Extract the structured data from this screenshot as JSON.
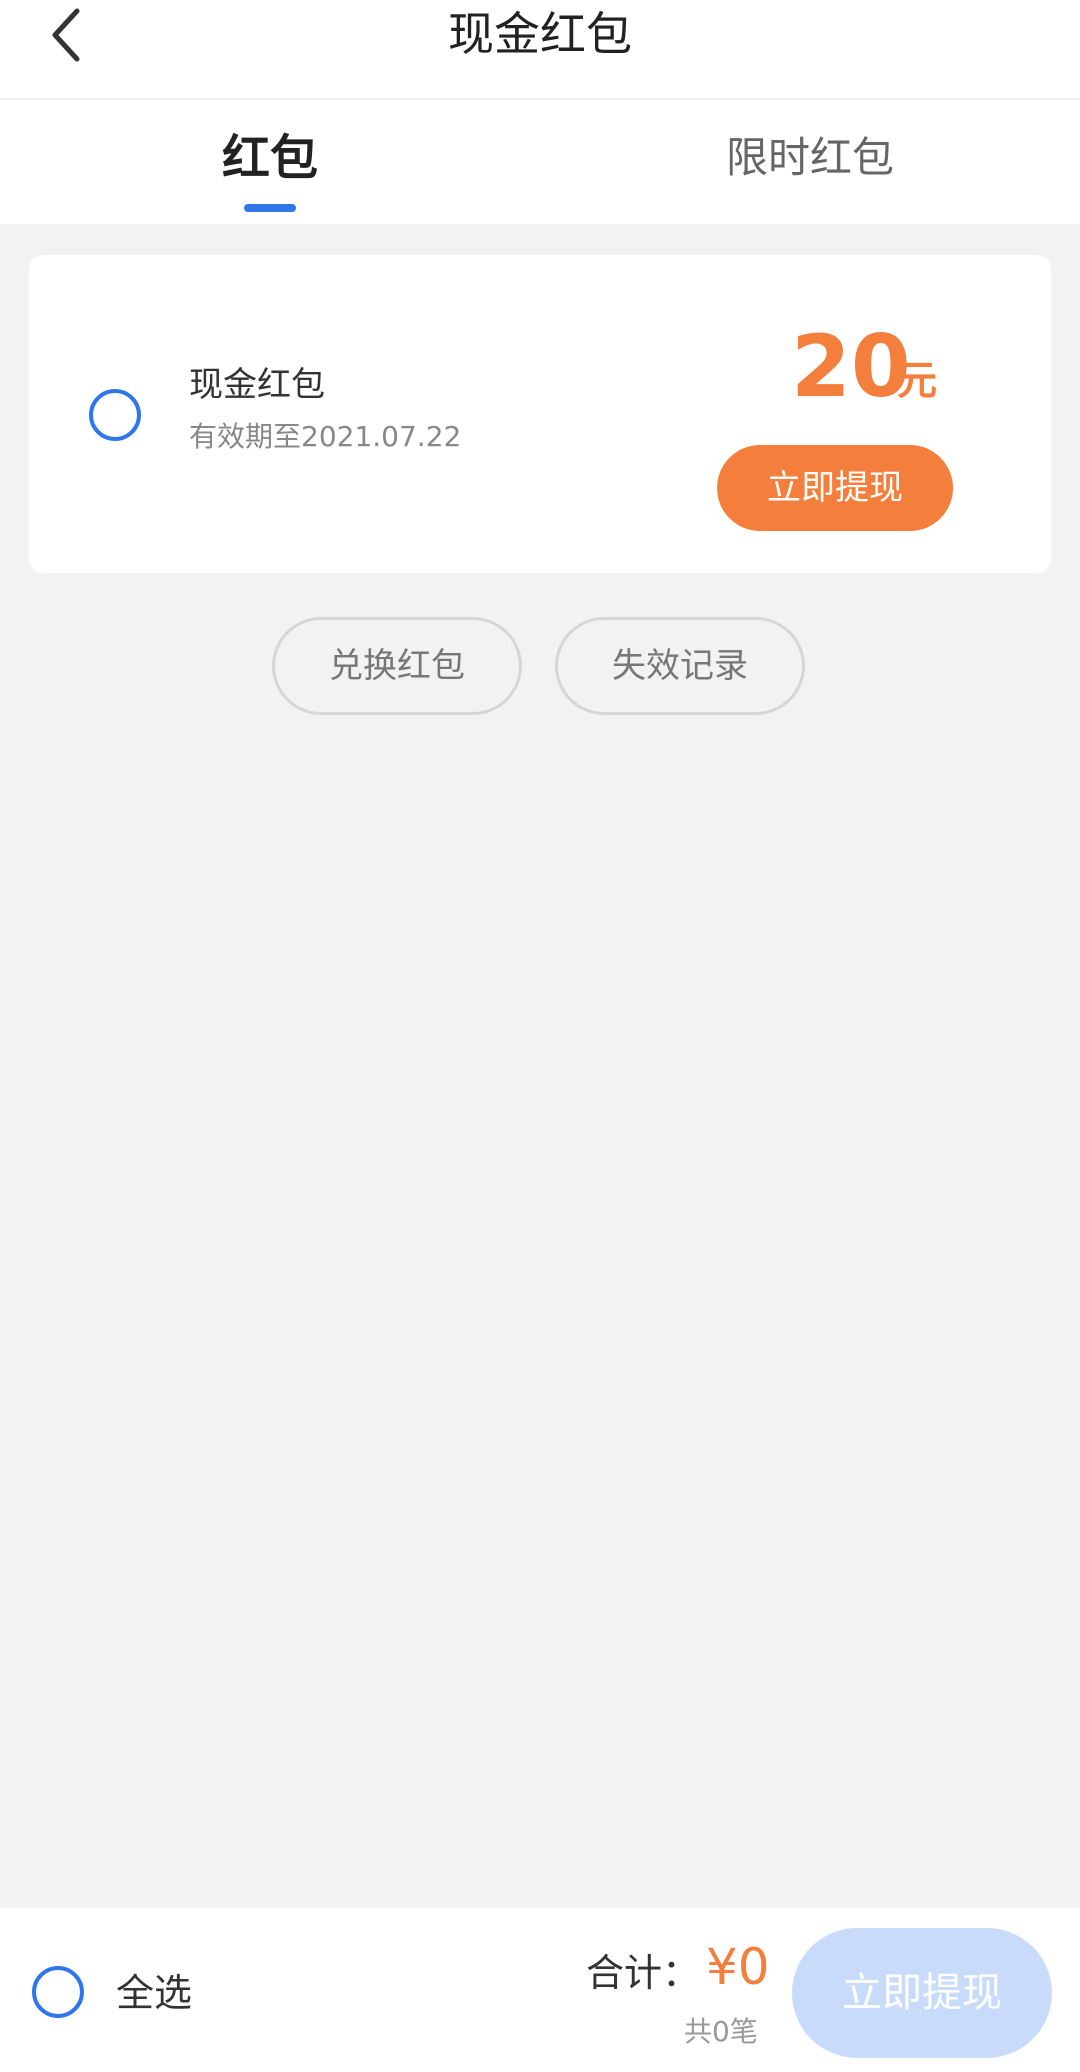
{
  "header": {
    "title": "现金红包"
  },
  "tabs": [
    {
      "label": "红包",
      "active": true
    },
    {
      "label": "限时红包",
      "active": false
    }
  ],
  "colors": {
    "accent_blue": "#2f76ea",
    "accent_orange": "#f47f3c",
    "disabled_button": "#c9dbfb",
    "page_background": "#f2f2f2"
  },
  "coupon": {
    "title": "现金红包",
    "expiry": "有效期至2021.07.22",
    "amount": "20",
    "unit": "元",
    "button_label": "立即提现",
    "selected": false
  },
  "actions": {
    "exchange_label": "兑换红包",
    "expired_label": "失效记录"
  },
  "footer": {
    "select_all_label": "全选",
    "total_label": "合计：",
    "total_value": "¥0",
    "count_text": "共0笔",
    "withdraw_label": "立即提现"
  },
  "icons": {
    "back": "chevron-left-icon",
    "radio": "radio-unchecked-icon"
  }
}
